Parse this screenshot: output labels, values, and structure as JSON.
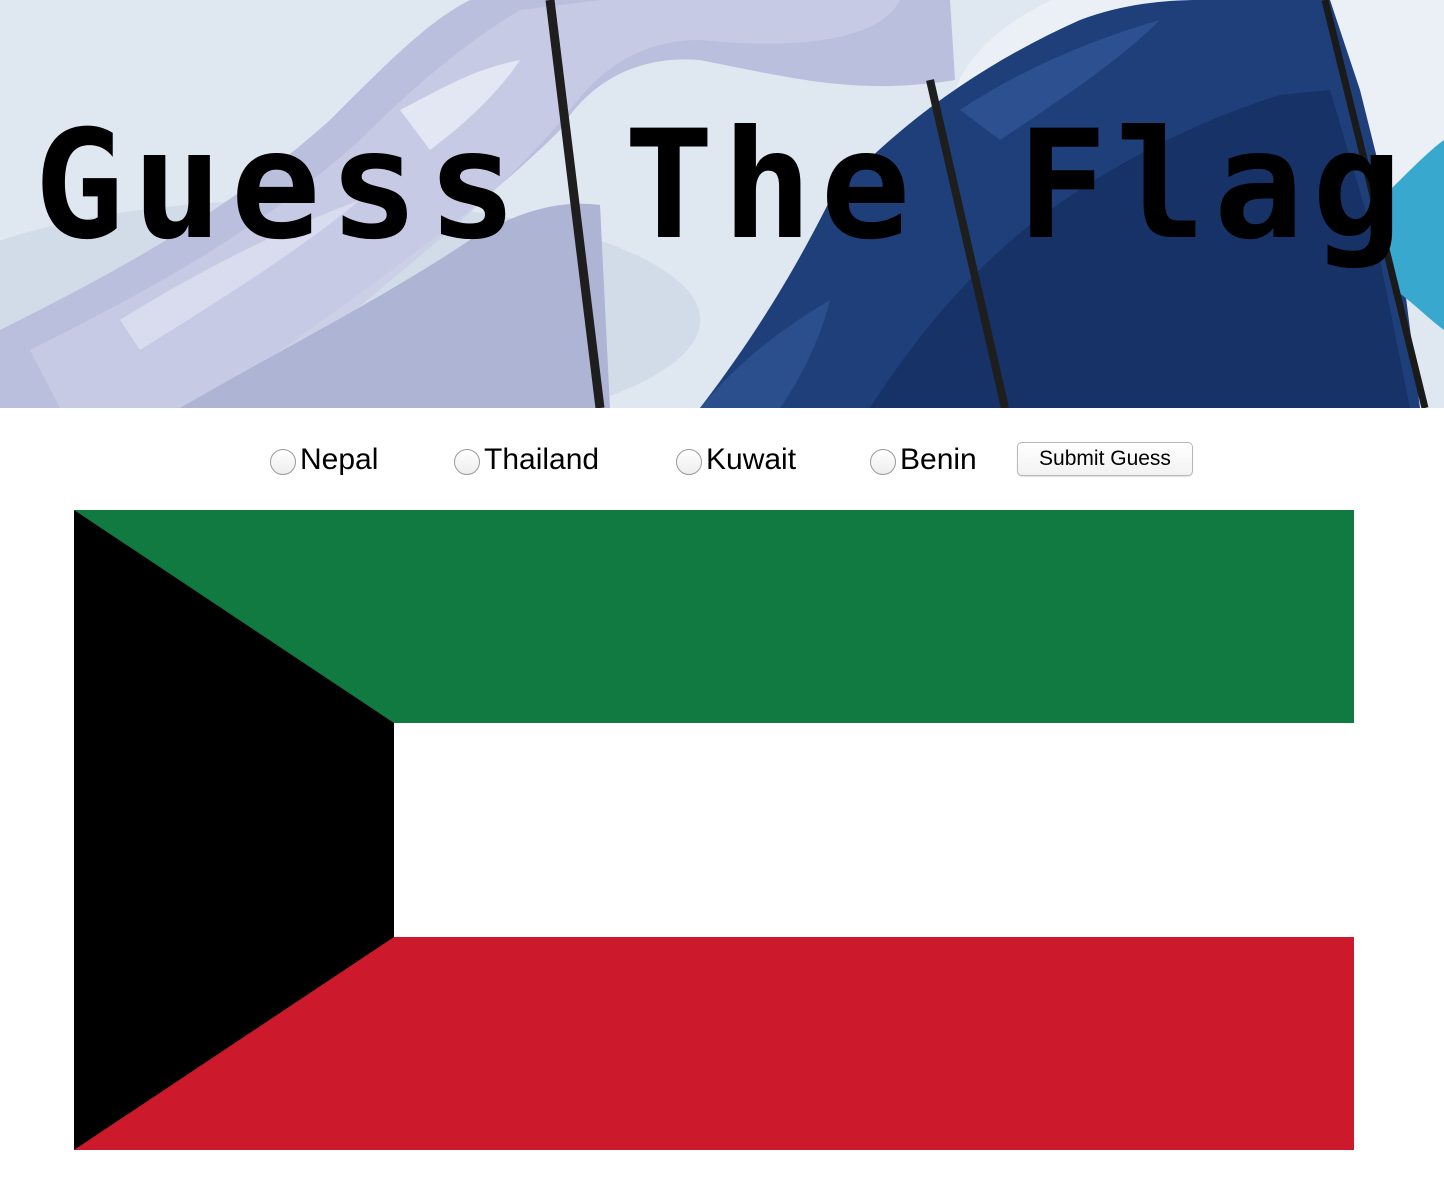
{
  "header": {
    "title": "Guess The Flag"
  },
  "quiz": {
    "options": [
      {
        "label": "Nepal"
      },
      {
        "label": "Thailand"
      },
      {
        "label": "Kuwait"
      },
      {
        "label": "Benin"
      }
    ],
    "submit_label": "Submit Guess"
  },
  "flag": {
    "colors": {
      "top": "#117a40",
      "middle": "#ffffff",
      "bottom": "#cc1a2c",
      "hoist": "#000000"
    }
  }
}
